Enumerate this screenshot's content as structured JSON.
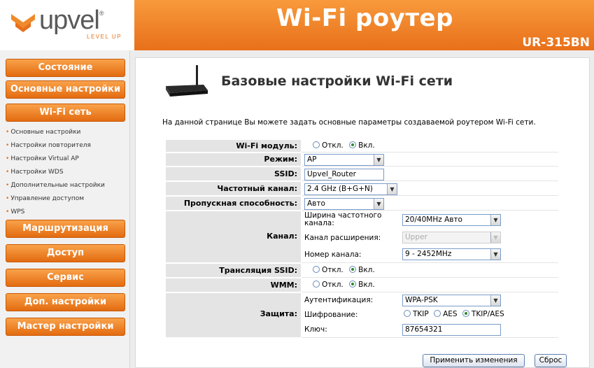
{
  "brand": {
    "logo_text": "upvel",
    "logo_reg": "®",
    "logo_sub": "LEVEL UP",
    "header_title": "Wi-Fi роутер",
    "model": "UR-315BN"
  },
  "sidebar": {
    "nav": [
      {
        "label": "Состояние"
      },
      {
        "label": "Основные настройки"
      },
      {
        "label": "Wi-Fi сеть"
      },
      {
        "label": "Маршрутизация"
      },
      {
        "label": "Доступ"
      },
      {
        "label": "Сервис"
      },
      {
        "label": "Доп. настройки"
      },
      {
        "label": "Мастер настройки"
      }
    ],
    "submenu": [
      {
        "label": "Основные настройки"
      },
      {
        "label": "Настройки повторителя"
      },
      {
        "label": "Настройки Virtual AP"
      },
      {
        "label": "Настройки WDS"
      },
      {
        "label": "Дополнительные настройки"
      },
      {
        "label": "Управление доступом"
      },
      {
        "label": "WPS"
      }
    ]
  },
  "main": {
    "title": "Базовые настройки Wi-Fi сети",
    "description": "На данной странице Вы можете задать основные параметры создаваемой роутером Wi-Fi сети.",
    "wifi_module": {
      "label": "Wi-Fi модуль:",
      "off": "Откл.",
      "on": "Вкл.",
      "selected": "on"
    },
    "mode": {
      "label": "Режим:",
      "value": "AP"
    },
    "ssid": {
      "label": "SSID:",
      "value": "Upvel_Router"
    },
    "band": {
      "label": "Частотный канал:",
      "value": "2.4 GHz (B+G+N)"
    },
    "bandwidth": {
      "label": "Пропускная способность:",
      "value": "Авто"
    },
    "channel": {
      "label": "Канал:",
      "width_label": "Ширина частотного канала:",
      "width_value": "20/40MHz Авто",
      "ext_label": "Канал расширения:",
      "ext_value": "Upper",
      "num_label": "Номер канала:",
      "num_value": "9 - 2452MHz"
    },
    "ssid_broadcast": {
      "label": "Трансляция SSID:",
      "off": "Откл.",
      "on": "Вкл.",
      "selected": "on"
    },
    "wmm": {
      "label": "WMM:",
      "off": "Откл.",
      "on": "Вкл.",
      "selected": "on"
    },
    "security": {
      "label": "Защита:",
      "auth_label": "Аутентификация:",
      "auth_value": "WPA-PSK",
      "enc_label": "Шифрование:",
      "enc_tkip": "TKIP",
      "enc_aes": "AES",
      "enc_both": "TKIP/AES",
      "enc_selected": "TKIP/AES",
      "key_label": "Ключ:",
      "key_value": "87654321"
    },
    "apply_button": "Применить изменения",
    "reset_button": "Сброс"
  },
  "colors": {
    "accent": "#e8701a",
    "accent_light": "#f9a24a",
    "label_bg": "#e4e4e4"
  }
}
